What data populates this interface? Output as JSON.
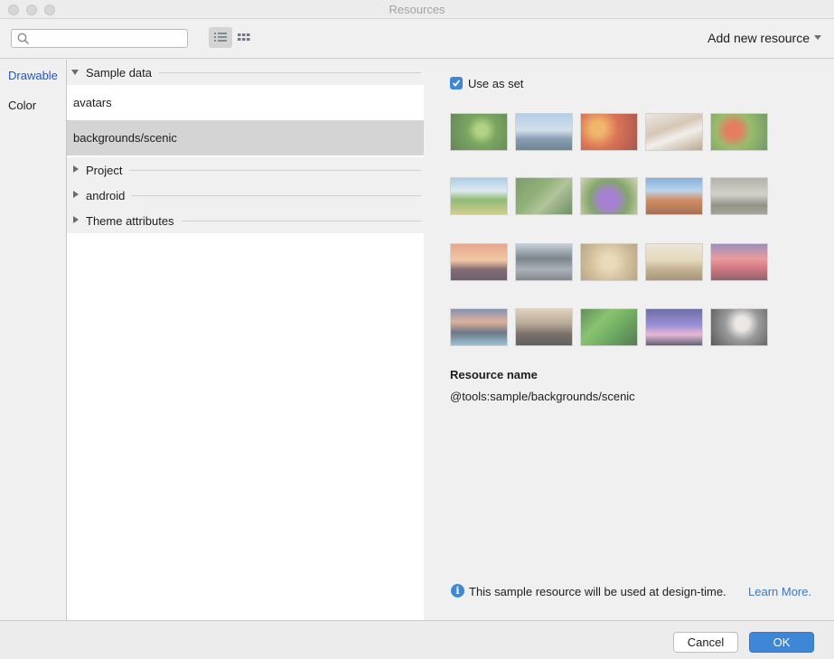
{
  "window": {
    "title": "Resources"
  },
  "toolbar": {
    "search_placeholder": "",
    "add_new_resource": "Add new resource"
  },
  "categories": [
    "Drawable",
    "Color"
  ],
  "resource_list": {
    "sample_data_header": "Sample data",
    "sample_items": [
      "avatars",
      "backgrounds/scenic"
    ],
    "collapsed_sections": [
      "Project",
      "android",
      "Theme attributes"
    ]
  },
  "detail": {
    "use_as_set_label": "Use as set",
    "use_as_set_checked": true,
    "resource_name_heading": "Resource name",
    "resource_name_value": "@tools:sample/backgrounds/scenic",
    "info_text": "This sample resource will be used at design-time.",
    "learn_more": "Learn More."
  },
  "buttons": {
    "cancel": "Cancel",
    "ok": "OK"
  },
  "colors": {
    "accent": "#3e87d7",
    "link": "#3a78c2",
    "selected_category": "#2255cc"
  }
}
